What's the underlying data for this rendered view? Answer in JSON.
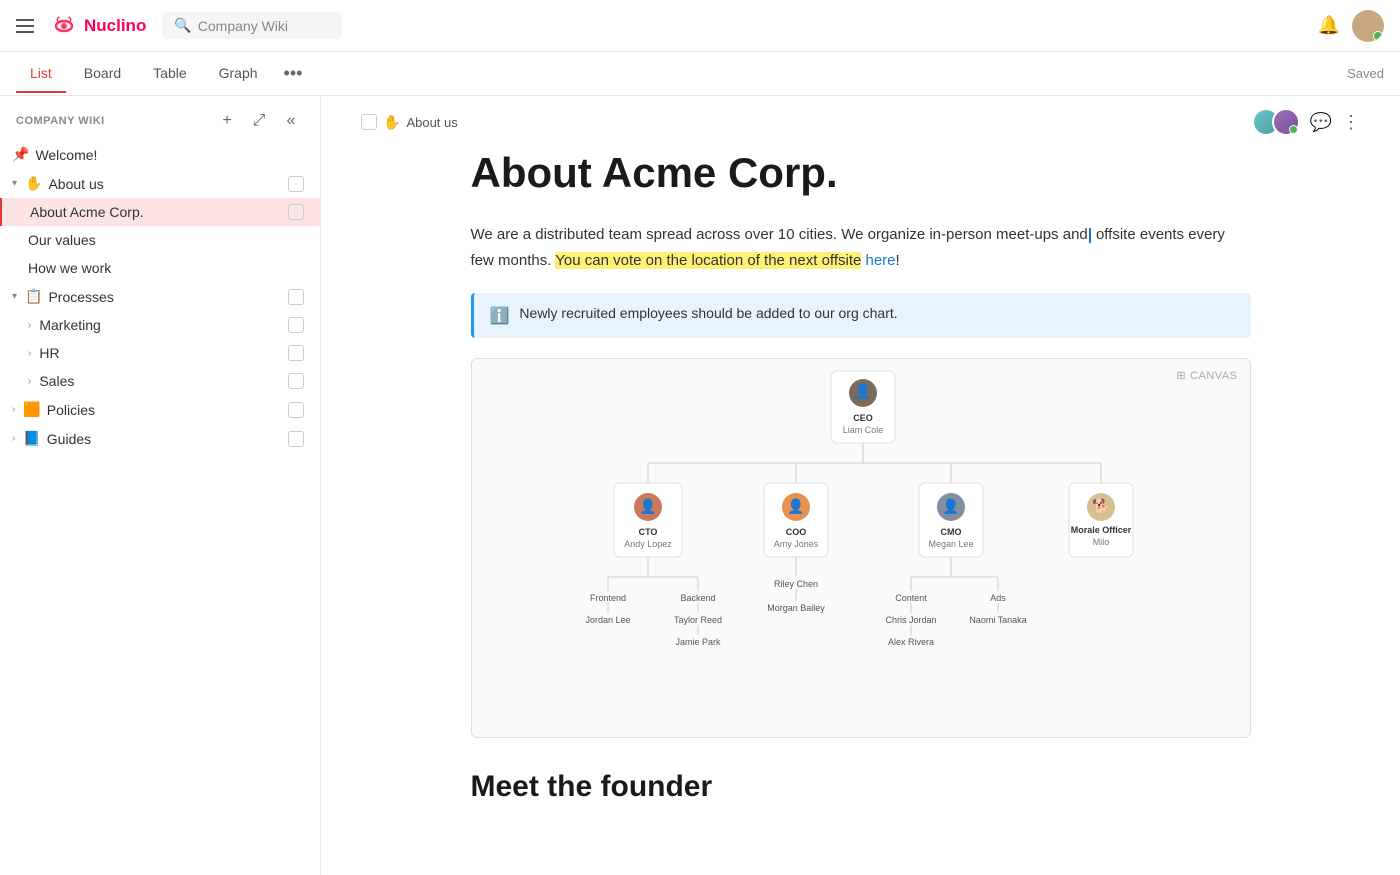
{
  "app": {
    "name": "Nuclino",
    "search_placeholder": "Company Wiki"
  },
  "tabs": [
    {
      "label": "List",
      "active": true
    },
    {
      "label": "Board",
      "active": false
    },
    {
      "label": "Table",
      "active": false
    },
    {
      "label": "Graph",
      "active": false
    }
  ],
  "toolbar": {
    "saved_label": "Saved"
  },
  "sidebar": {
    "title": "COMPANY WIKI",
    "items": [
      {
        "label": "Welcome!",
        "icon": "📌",
        "level": 0,
        "type": "item"
      },
      {
        "label": "About us",
        "icon": "✋",
        "level": 0,
        "type": "section",
        "expanded": true
      },
      {
        "label": "About Acme Corp.",
        "icon": "",
        "level": 1,
        "type": "item",
        "active": true
      },
      {
        "label": "Our values",
        "icon": "",
        "level": 1,
        "type": "item"
      },
      {
        "label": "How we work",
        "icon": "",
        "level": 1,
        "type": "item"
      },
      {
        "label": "Processes",
        "icon": "📋",
        "level": 0,
        "type": "section",
        "expanded": true
      },
      {
        "label": "Marketing",
        "icon": "",
        "level": 1,
        "type": "item",
        "has_children": true
      },
      {
        "label": "HR",
        "icon": "",
        "level": 1,
        "type": "item",
        "has_children": true
      },
      {
        "label": "Sales",
        "icon": "",
        "level": 1,
        "type": "item",
        "has_children": true
      },
      {
        "label": "Policies",
        "icon": "🟧",
        "level": 0,
        "type": "item",
        "has_children": true
      },
      {
        "label": "Guides",
        "icon": "📘",
        "level": 0,
        "type": "item",
        "has_children": true
      }
    ]
  },
  "breadcrumb": {
    "icon": "✋",
    "text": "About us"
  },
  "page": {
    "title": "About Acme Corp.",
    "body_1": "We are a distributed team spread across over 10 cities. We organize in-person meet-ups and offsite events every few months. You can vote on the location of the next offsite ",
    "body_link": "here",
    "body_2": "!",
    "info_text": "Newly recruited employees should be added to our org chart.",
    "section2_title": "Meet the founder"
  },
  "org_chart": {
    "ceo": {
      "title": "CEO",
      "name": "Liam Cole",
      "emoji": "👤"
    },
    "level2": [
      {
        "title": "CTO",
        "name": "Andy Lopez",
        "emoji": "👤"
      },
      {
        "title": "COO",
        "name": "Amy Jones",
        "emoji": "👤"
      },
      {
        "title": "CMO",
        "name": "Megan Lee",
        "emoji": "👤"
      },
      {
        "title": "Morale Officer",
        "name": "Milo",
        "emoji": "🐕"
      }
    ],
    "level3_cto": [
      {
        "label": "Frontend",
        "children": [
          "Jordan Lee"
        ]
      },
      {
        "label": "Backend",
        "children": [
          "Taylor Reed",
          "Jamie Park"
        ]
      }
    ],
    "level3_coo": [
      {
        "label": "Riley Chen",
        "children": [
          "Morgan Bailey"
        ]
      }
    ],
    "level3_cmo": [
      {
        "label": "Content",
        "children": [
          "Chris Jordan",
          "Alex Rivera"
        ]
      },
      {
        "label": "Ads",
        "children": [
          "Naomi Tanaka"
        ]
      }
    ]
  },
  "icons": {
    "hamburger": "☰",
    "search": "🔍",
    "bell": "🔔",
    "plus": "+",
    "expand": "⤢",
    "collapse": "«",
    "comment": "💬",
    "more": "⋯",
    "canvas": "⊞",
    "info": "ℹ"
  },
  "colors": {
    "accent": "#e53935",
    "link": "#1976d2",
    "info_bg": "#e8f4fd",
    "info_border": "#2196f3"
  }
}
